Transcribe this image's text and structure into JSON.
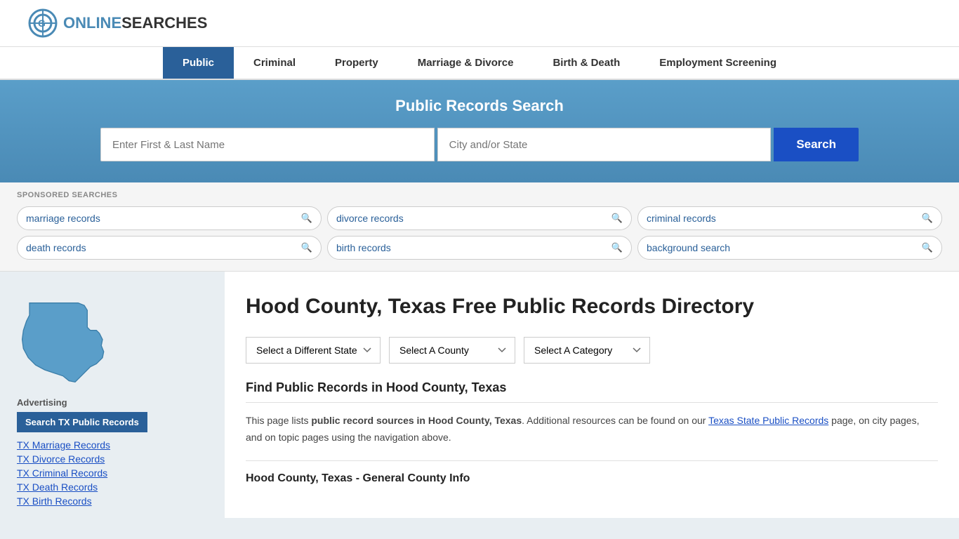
{
  "header": {
    "logo_text_part1": "ONLINE",
    "logo_text_part2": "SEARCHES"
  },
  "nav": {
    "items": [
      {
        "label": "Public",
        "active": true
      },
      {
        "label": "Criminal",
        "active": false
      },
      {
        "label": "Property",
        "active": false
      },
      {
        "label": "Marriage & Divorce",
        "active": false
      },
      {
        "label": "Birth & Death",
        "active": false
      },
      {
        "label": "Employment Screening",
        "active": false
      }
    ]
  },
  "banner": {
    "title": "Public Records Search",
    "name_placeholder": "Enter First & Last Name",
    "city_placeholder": "City and/or State",
    "search_button": "Search"
  },
  "sponsored": {
    "label": "SPONSORED SEARCHES",
    "tags": [
      {
        "label": "marriage records"
      },
      {
        "label": "divorce records"
      },
      {
        "label": "criminal records"
      },
      {
        "label": "death records"
      },
      {
        "label": "birth records"
      },
      {
        "label": "background search"
      }
    ]
  },
  "content": {
    "page_title": "Hood County, Texas Free Public Records Directory",
    "dropdowns": {
      "state": "Select a Different State",
      "county": "Select A County",
      "category": "Select A Category"
    },
    "find_heading": "Find Public Records in Hood County, Texas",
    "description_part1": "This page lists ",
    "description_bold": "public record sources in Hood County, Texas",
    "description_part2": ". Additional resources can be found on our ",
    "description_link": "Texas State Public Records",
    "description_part3": " page, on city pages, and on topic pages using the navigation above.",
    "bottom_title": "Hood County, Texas - General County Info"
  },
  "sidebar": {
    "advertising_label": "Advertising",
    "ad_button": "Search TX Public Records",
    "links": [
      {
        "label": "TX Marriage Records"
      },
      {
        "label": "TX Divorce Records"
      },
      {
        "label": "TX Criminal Records"
      },
      {
        "label": "TX Death Records"
      },
      {
        "label": "TX Birth Records"
      }
    ]
  }
}
